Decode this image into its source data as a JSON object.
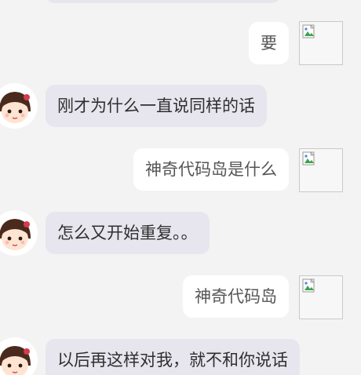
{
  "conversation": {
    "messages": [
      {
        "role": "user",
        "text": "要"
      },
      {
        "role": "bot",
        "text": "刚才为什么一直说同样的话"
      },
      {
        "role": "user",
        "text": "神奇代码岛是什么"
      },
      {
        "role": "bot",
        "text": "怎么又开始重复。。"
      },
      {
        "role": "user",
        "text": "神奇代码岛"
      },
      {
        "role": "bot",
        "text": "以后再这样对我，就不和你说话"
      }
    ]
  },
  "icons": {
    "user_avatar": "broken-image-icon",
    "bot_avatar": "girl-avatar-icon"
  }
}
